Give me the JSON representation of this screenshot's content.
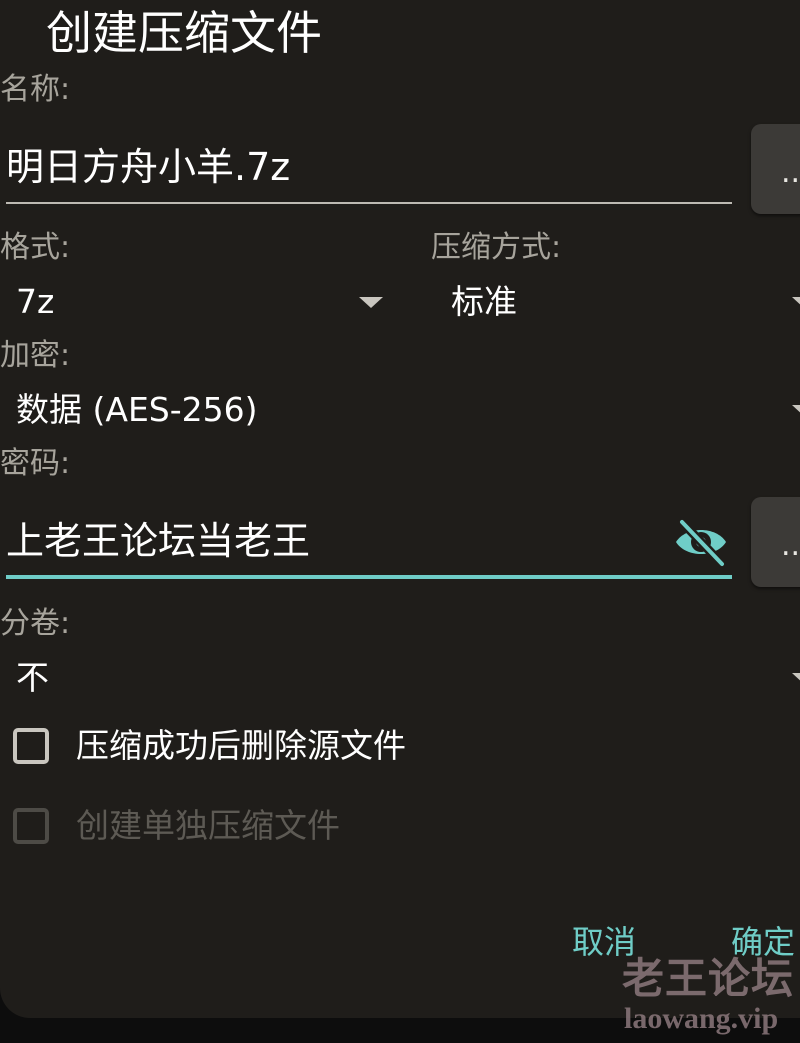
{
  "dialog": {
    "title": "创建压缩文件"
  },
  "name_field": {
    "label": "名称:",
    "value": "明日方舟小羊.7z",
    "browse_label": "..."
  },
  "format": {
    "label": "格式:",
    "selected": "7z"
  },
  "compression_method": {
    "label": "压缩方式:",
    "selected": "标准"
  },
  "encryption": {
    "label": "加密:",
    "selected": "数据 (AES-256)"
  },
  "password": {
    "label": "密码:",
    "value": "上老王论坛当老王",
    "icon": "eye-off-icon",
    "browse_label": "..."
  },
  "split_volume": {
    "label": "分卷:",
    "selected": "不"
  },
  "options": {
    "delete_source": {
      "label": "压缩成功后删除源文件",
      "checked": false,
      "enabled": true
    },
    "separate_archives": {
      "label": "创建单独压缩文件",
      "checked": false,
      "enabled": false
    }
  },
  "actions": {
    "cancel_label": "取消",
    "ok_label": "确定"
  },
  "watermark": {
    "name": "老王论坛",
    "url": "laowang.vip"
  },
  "colors": {
    "accent": "#6fcdc7",
    "background": "#1f1d1a",
    "label": "#a7a49c"
  }
}
